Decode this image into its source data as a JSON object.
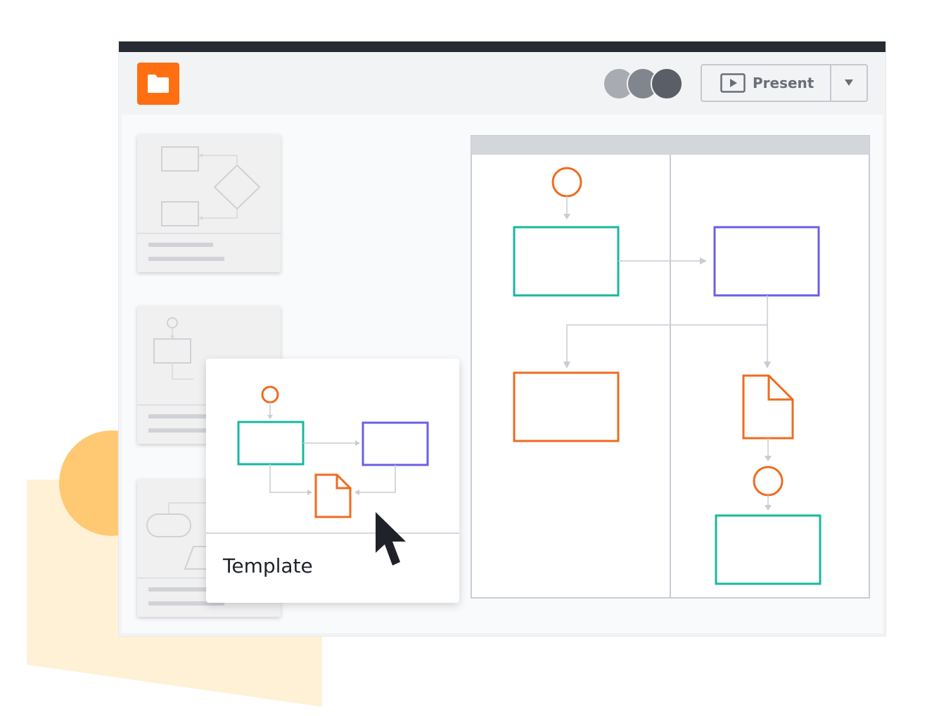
{
  "app": {
    "logo_icon": "folder-icon",
    "brand_color": "#ff6f12"
  },
  "header": {
    "collaborators": [
      {
        "color": "#a8abb1"
      },
      {
        "color": "#81858d"
      },
      {
        "color": "#5a5e67"
      }
    ],
    "present_label": "Present",
    "present_icon": "play-icon",
    "dropdown_icon": "chevron-down-icon"
  },
  "template_card": {
    "label": "Template"
  },
  "colors": {
    "teal": "#17b8a0",
    "purple": "#6b5ee8",
    "orange": "#f06b1f",
    "connector": "#c9ccd2"
  }
}
